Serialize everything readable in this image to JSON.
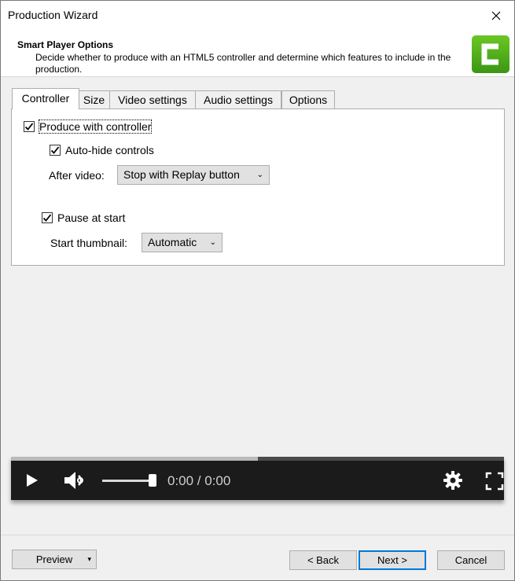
{
  "window": {
    "title": "Production Wizard"
  },
  "header": {
    "title": "Smart Player Options",
    "description": "Decide whether to produce with an HTML5 controller and determine which features to include in the production."
  },
  "tabs": [
    {
      "label": "Controller",
      "active": true
    },
    {
      "label": "Size",
      "active": false
    },
    {
      "label": "Video settings",
      "active": false
    },
    {
      "label": "Audio settings",
      "active": false
    },
    {
      "label": "Options",
      "active": false
    }
  ],
  "controller": {
    "produce_with_controller": {
      "label": "Produce with controller",
      "checked": true
    },
    "auto_hide": {
      "label": "Auto-hide controls",
      "checked": true
    },
    "after_video": {
      "label": "After video:",
      "value": "Stop with Replay button"
    },
    "pause_at_start": {
      "label": "Pause at start",
      "checked": true
    },
    "start_thumbnail": {
      "label": "Start thumbnail:",
      "value": "Automatic"
    }
  },
  "player": {
    "time_display": "0:00 / 0:00",
    "progress_fraction": 0.5,
    "volume_fraction": 1.0
  },
  "buttons": {
    "preview": "Preview",
    "back": "< Back",
    "next": "Next >",
    "cancel": "Cancel"
  },
  "colors": {
    "logo_green": "#5bb31d",
    "accent_blue": "#0078d7",
    "player_bg": "#1b1b1b"
  }
}
